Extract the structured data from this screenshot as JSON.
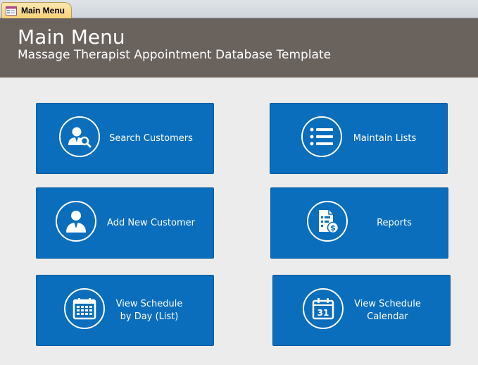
{
  "tab": {
    "label": "Main Menu"
  },
  "header": {
    "title": "Main Menu",
    "subtitle": "Massage Therapist Appointment Database Template",
    "background": "#69625d"
  },
  "colors": {
    "button": "#0a6ebd",
    "page": "#ececec"
  },
  "buttons": {
    "search_customers": {
      "label": "Search Customers",
      "icon": "customer-search-icon"
    },
    "maintain_lists": {
      "label": "Maintain Lists",
      "icon": "list-icon"
    },
    "add_new_customer": {
      "label": "Add New Customer",
      "icon": "person-icon"
    },
    "reports": {
      "label": "Reports",
      "icon": "report-dollar-icon"
    },
    "view_schedule_day": {
      "line1": "View Schedule",
      "line2": "by Day (List)",
      "icon": "calendar-grid-icon"
    },
    "view_schedule_calendar": {
      "line1": "View Schedule",
      "line2": "Calendar",
      "icon": "calendar-31-icon"
    }
  }
}
